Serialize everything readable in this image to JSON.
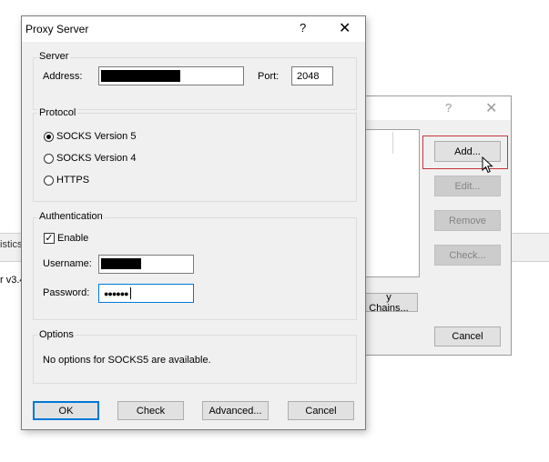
{
  "background": {
    "tab_fragment": "istics",
    "version_fragment": "r v3.4"
  },
  "back_dialog": {
    "help": "?",
    "close": "✕",
    "buttons": {
      "add": "Add...",
      "edit": "Edit...",
      "remove": "Remove",
      "check": "Check...",
      "proxy_chains": "y Chains...",
      "cancel": "Cancel"
    }
  },
  "dialog": {
    "title": "Proxy Server",
    "help": "?",
    "close": "✕",
    "server": {
      "legend": "Server",
      "address_label": "Address:",
      "port_label": "Port:",
      "port_value": "2048"
    },
    "protocol": {
      "legend": "Protocol",
      "options": [
        "SOCKS Version 5",
        "SOCKS Version 4",
        "HTTPS"
      ],
      "selected": "SOCKS Version 5"
    },
    "authentication": {
      "legend": "Authentication",
      "enable_label": "Enable",
      "enable_checked": true,
      "check_glyph": "✓",
      "username_label": "Username:",
      "password_label": "Password:",
      "password_value": "●●●●●●"
    },
    "options": {
      "legend": "Options",
      "text": "No options for SOCKS5 are available."
    },
    "buttons": {
      "ok": "OK",
      "check": "Check",
      "advanced": "Advanced...",
      "cancel": "Cancel"
    }
  },
  "colors": {
    "dialog_bg": "#f0f0f0",
    "focus_accent": "#0078d7",
    "highlight_red": "#c6363c"
  }
}
